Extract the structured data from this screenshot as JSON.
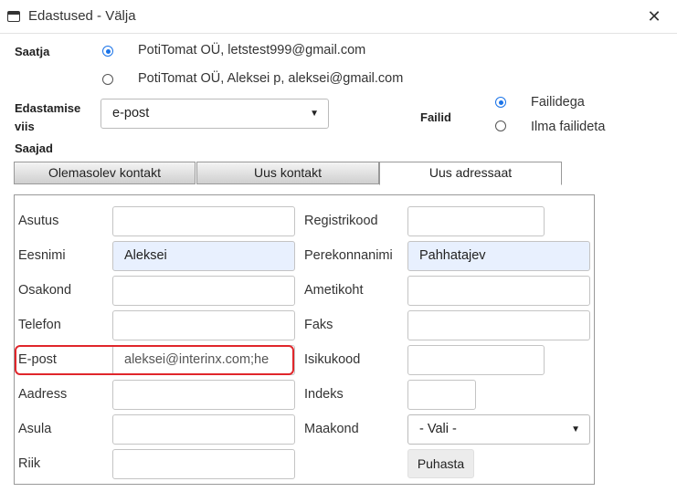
{
  "window": {
    "title": "Edastused - Välja",
    "close_symbol": "✕"
  },
  "sender": {
    "label": "Saatja",
    "options": [
      {
        "text": "PotiTomat OÜ, letstest999@gmail.com",
        "checked": true
      },
      {
        "text": "PotiTomat OÜ, Aleksei p, aleksei@gmail.com",
        "checked": false
      }
    ]
  },
  "delivery": {
    "label_line1": "Edastamise",
    "label_line2": "viis",
    "selected": "e-post",
    "caret": "▼"
  },
  "files": {
    "label": "Failid",
    "options": [
      {
        "text": "Failidega",
        "checked": true
      },
      {
        "text": "Ilma failideta",
        "checked": false
      }
    ]
  },
  "recipients": {
    "label": "Saajad",
    "tabs": [
      "Olemasolev kontakt",
      "Uus kontakt",
      "Uus adressaat"
    ],
    "active_tab": 2
  },
  "form": {
    "asutus": {
      "label": "Asutus",
      "value": ""
    },
    "registrikood": {
      "label": "Registrikood",
      "value": ""
    },
    "eesnimi": {
      "label": "Eesnimi",
      "value": "Aleksei"
    },
    "perekonnanimi": {
      "label": "Perekonnanimi",
      "value": "Pahhatajev"
    },
    "osakond": {
      "label": "Osakond",
      "value": ""
    },
    "ametikoht": {
      "label": "Ametikoht",
      "value": ""
    },
    "telefon": {
      "label": "Telefon",
      "value": ""
    },
    "faks": {
      "label": "Faks",
      "value": ""
    },
    "epost": {
      "label": "E-post",
      "value": "aleksei@interinx.com;he"
    },
    "isikukood": {
      "label": "Isikukood",
      "value": ""
    },
    "aadress": {
      "label": "Aadress",
      "value": ""
    },
    "indeks": {
      "label": "Indeks",
      "value": ""
    },
    "asula": {
      "label": "Asula",
      "value": ""
    },
    "maakond": {
      "label": "Maakond",
      "selected": "- Vali -",
      "caret": "▼"
    },
    "riik": {
      "label": "Riik",
      "value": ""
    },
    "clear_button": "Puhasta"
  },
  "colors": {
    "accent": "#1a73e8",
    "highlight": "#e0262b",
    "autofill": "#e8f0fe"
  }
}
